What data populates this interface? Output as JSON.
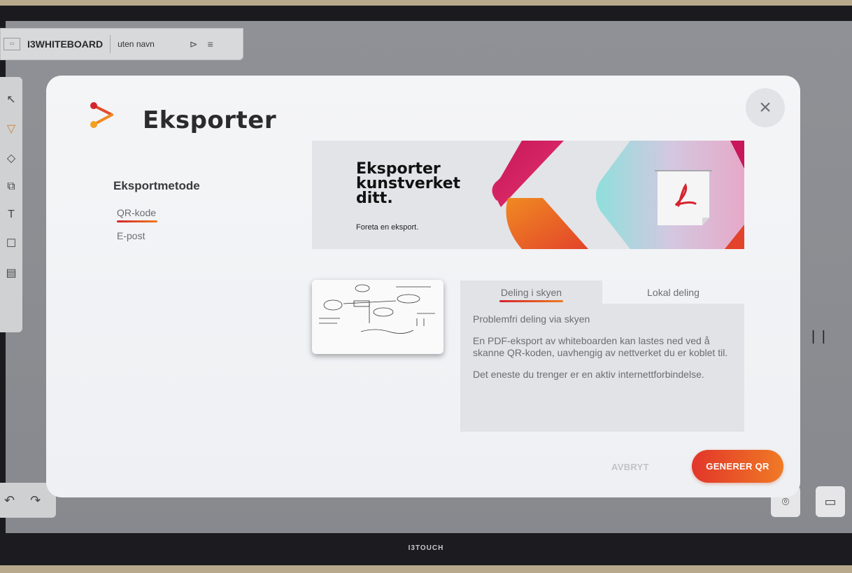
{
  "app": {
    "name": "I3WHITEBOARD",
    "file_name": "uten navn",
    "device_brand": "I3TOUCH"
  },
  "modal": {
    "title": "Eksporter",
    "close_label": "×",
    "export_method": {
      "heading": "Eksportmetode",
      "options": [
        {
          "label": "QR-kode",
          "active": true
        },
        {
          "label": "E-post",
          "active": false
        }
      ]
    },
    "banner": {
      "title": "Eksporter kunstverket ditt.",
      "subtitle": "Foreta en eksport."
    },
    "share": {
      "tabs": [
        {
          "label": "Deling i skyen",
          "active": true
        },
        {
          "label": "Lokal deling",
          "active": false
        }
      ],
      "heading": "Problemfri deling via skyen",
      "paragraph1": "En PDF-eksport av whiteboarden kan lastes ned ved å skanne QR-koden, uavhengig av nettverket du er koblet til.",
      "paragraph2": "Det eneste du trenger er en aktiv internettforbindelse."
    },
    "actions": {
      "cancel": "AVBRYT",
      "generate": "GENERER QR"
    }
  },
  "colors": {
    "accent_red": "#d6242e",
    "accent_orange": "#ee7a21",
    "modal_bg": "#f2f3f5",
    "panel_bg": "#e1e3e7"
  }
}
